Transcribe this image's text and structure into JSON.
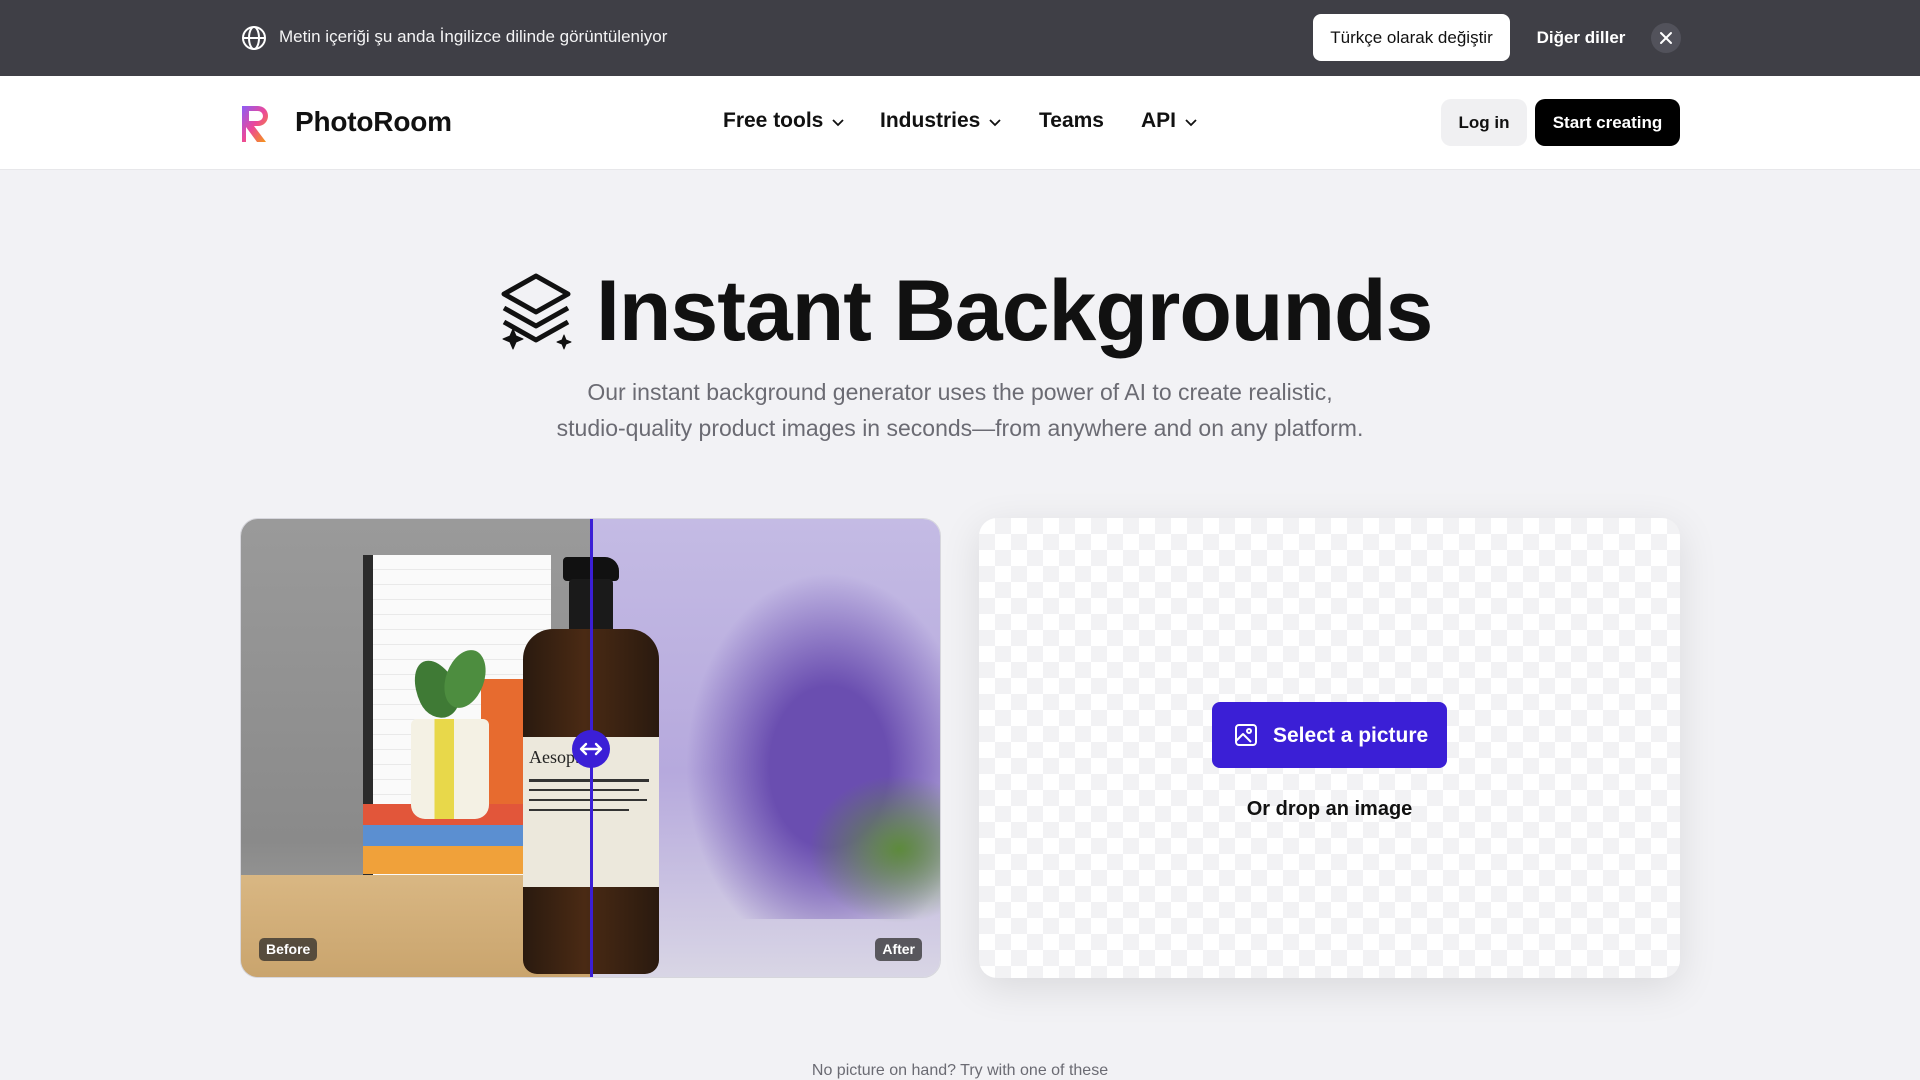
{
  "language_banner": {
    "message": "Metin içeriği şu anda İngilizce dilinde görüntüleniyor",
    "switch_label": "Türkçe olarak değiştir",
    "other_label": "Diğer diller"
  },
  "header": {
    "brand": "PhotoRoom",
    "nav": [
      {
        "label": "Free tools",
        "dropdown": true
      },
      {
        "label": "Industries",
        "dropdown": true
      },
      {
        "label": "Teams",
        "dropdown": false
      },
      {
        "label": "API",
        "dropdown": true
      }
    ],
    "login_label": "Log in",
    "start_label": "Start creating"
  },
  "hero": {
    "title": "Instant Backgrounds",
    "subtitle_line1": "Our instant background generator uses the power of AI to create realistic,",
    "subtitle_line2": "studio-quality product images in seconds—from anywhere and on any platform."
  },
  "compare": {
    "before_label": "Before",
    "after_label": "After",
    "product_label_brand": "Aesop."
  },
  "upload": {
    "select_label": "Select a picture",
    "drop_label": "Or drop an image"
  },
  "samples": {
    "prompt": "No picture on hand? Try with one of these"
  },
  "colors": {
    "accent": "#3b1fd6",
    "banner_bg": "#3f3f46",
    "page_bg": "#f2f2f5"
  }
}
